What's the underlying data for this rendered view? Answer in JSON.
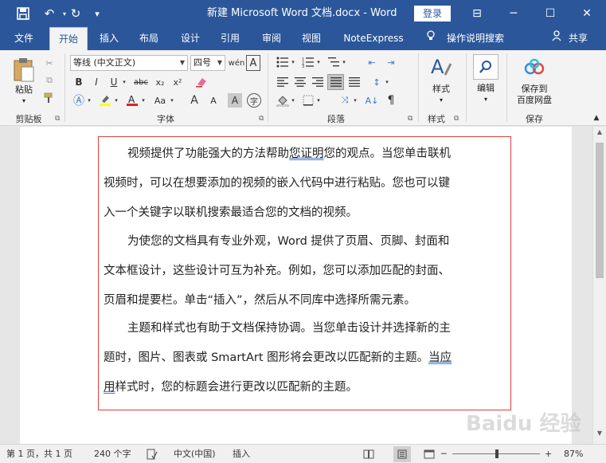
{
  "titlebar": {
    "title": "新建 Microsoft Word 文档.docx  -  Word",
    "login_label": "登录",
    "save_icon": "💾",
    "undo_icon": "↶",
    "redo_icon": "↻",
    "customize_icon": "▾",
    "ribbon_options_icon": "⊟",
    "minimize_icon": "─",
    "maximize_icon": "☐",
    "close_icon": "✕"
  },
  "tabs": [
    {
      "label": "文件"
    },
    {
      "label": "开始"
    },
    {
      "label": "插入"
    },
    {
      "label": "布局"
    },
    {
      "label": "设计"
    },
    {
      "label": "引用"
    },
    {
      "label": "审阅"
    },
    {
      "label": "视图"
    },
    {
      "label": "NoteExpress"
    }
  ],
  "tell_me": {
    "label": "操作说明搜索",
    "icon": "💡"
  },
  "share": {
    "label": "共享",
    "icon": "👤"
  },
  "ribbon": {
    "clipboard": {
      "label": "剪贴板",
      "paste": "粘贴"
    },
    "font": {
      "label": "字体",
      "font_name": "等线 (中文正文)",
      "font_size": "四号",
      "bold": "B",
      "italic": "I",
      "underline": "U",
      "strike": "abc",
      "subscript": "x₂",
      "superscript": "x²",
      "change_case": "Aa",
      "grow": "A",
      "shrink": "A",
      "char_border": "A",
      "phonetic": "wén"
    },
    "paragraph": {
      "label": "段落"
    },
    "styles": {
      "label": "样式",
      "button": "样式"
    },
    "editing": {
      "label": "编辑"
    },
    "save_group": {
      "label": "保存",
      "button_line1": "保存到",
      "button_line2": "百度网盘"
    }
  },
  "document": {
    "paragraphs": [
      [
        "视频提供了功能强大的方法帮助",
        "您证明",
        "您的观点。当您单击联机",
        "视频时，可以在想要添加的视频的嵌入代码中进行粘贴。您也可以键",
        "入一个关键字以联机搜索最适合您的文档的视频。"
      ],
      [
        "为使您的文档具有专业外观，Word 提供了页眉、页脚、封面和",
        "文本框设计，这些设计可互为补充。例如，您可以添加匹配的封面、",
        "页眉和提要栏。单击“插入”，然后从不同库中选择所需元素。"
      ],
      [
        "主题和样式也有助于文档保持协调。当您单击设计并选择新的主",
        "题时，图片、图表或 SmartArt 图形将会更改以匹配新的主题。",
        "当应",
        "用",
        "样式时，您的标题会进行更改以匹配新的主题。"
      ]
    ]
  },
  "statusbar": {
    "page": "第 1 页，共 1 页",
    "words": "240 个字",
    "language": "中文(中国)",
    "mode": "插入",
    "zoom": "87%",
    "zoom_minus": "─",
    "zoom_plus": "+",
    "zoom_level": 0.87
  },
  "watermark": "Baidu 经验"
}
